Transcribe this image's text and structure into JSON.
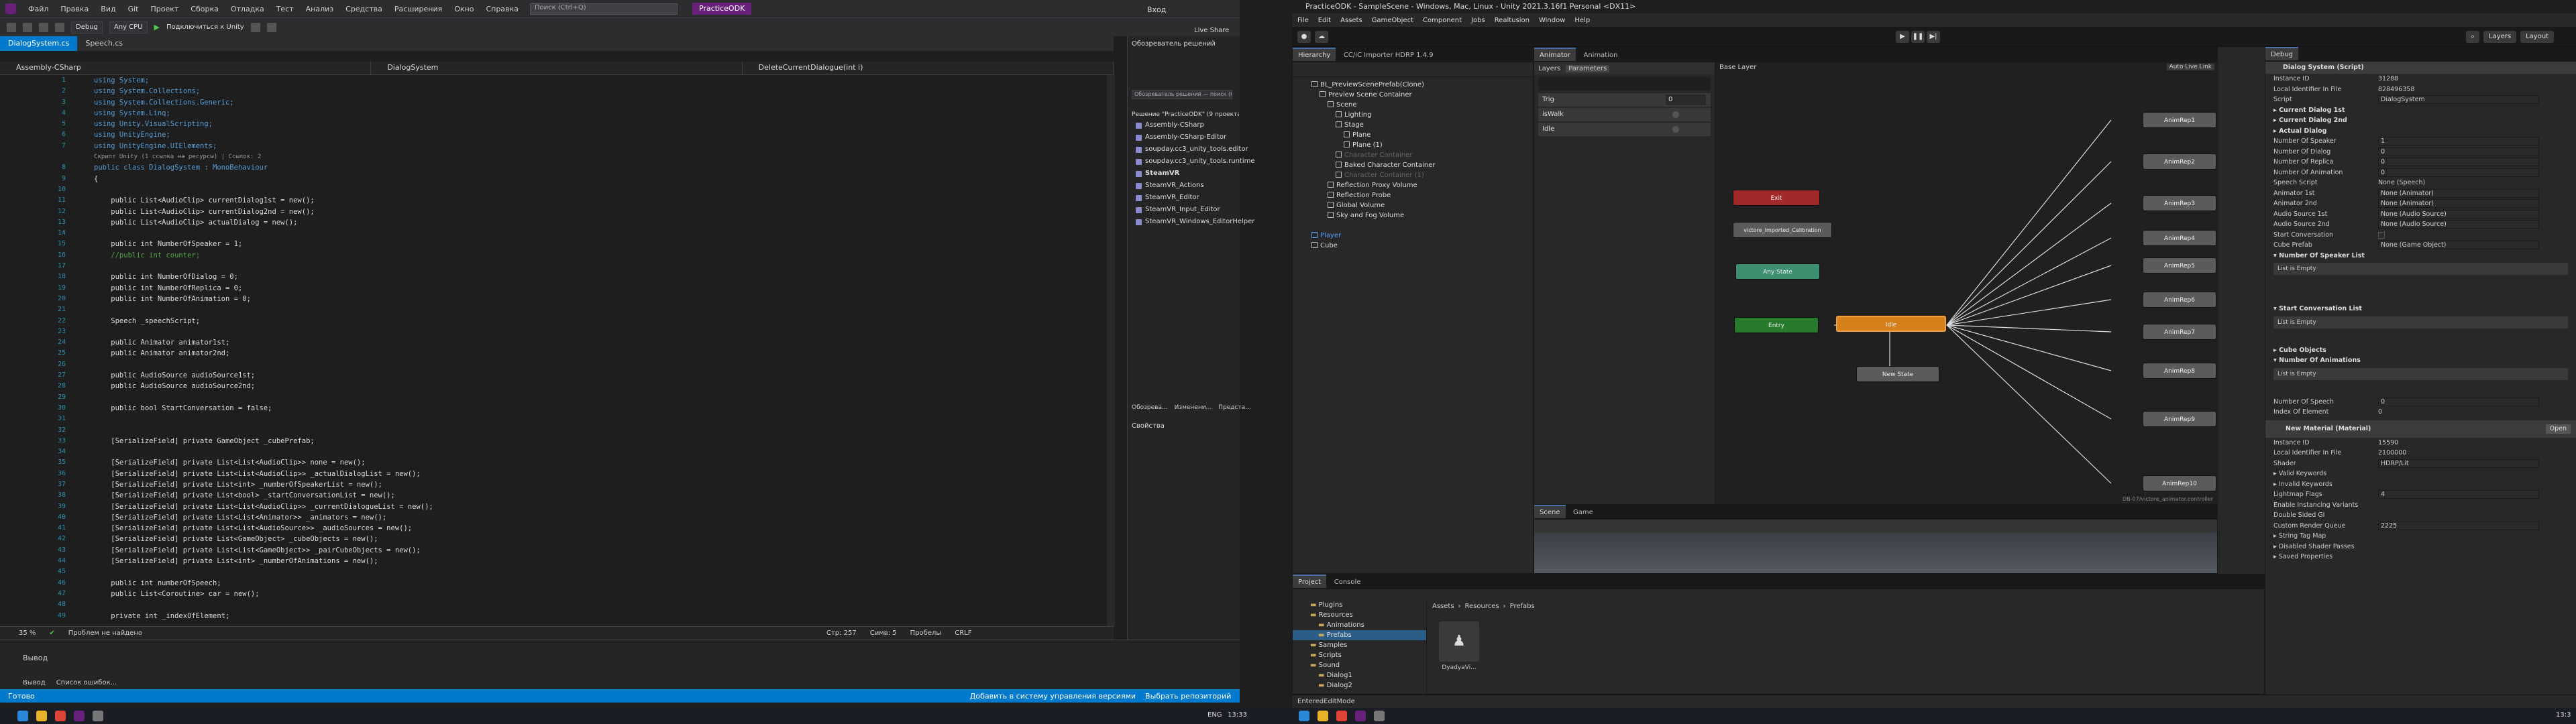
{
  "vs": {
    "menu": [
      "Файл",
      "Правка",
      "Вид",
      "Git",
      "Проект",
      "Сборка",
      "Отладка",
      "Тест",
      "Анализ",
      "Средства",
      "Расширения",
      "Окно",
      "Справка"
    ],
    "search_placeholder": "Поиск (Ctrl+Q)",
    "solution_name": "PracticeODK",
    "user": "Вход",
    "live_share": "Live Share",
    "config": "Debug",
    "platform": "Any CPU",
    "attach": "Подключиться к Unity",
    "tabs": [
      "DialogSystem.cs",
      "Speech.cs"
    ],
    "nav": [
      "Assembly-CSharp",
      "DialogSystem",
      "DeleteCurrentDialogue(int i)"
    ],
    "line_numbers": [
      "1",
      "2",
      "3",
      "4",
      "5",
      "6",
      "7",
      "8",
      "9",
      "10",
      "11",
      "12",
      "13",
      "14",
      "15",
      "16",
      "17",
      "18",
      "19",
      "20",
      "21",
      "22",
      "23",
      "24",
      "25",
      "26",
      "27",
      "28",
      "29",
      "30",
      "31",
      "32",
      "33",
      "34",
      "35",
      "36",
      "37",
      "38",
      "39",
      "40",
      "41",
      "42",
      "43",
      "44",
      "45",
      "46",
      "47",
      "48",
      "49",
      "50"
    ],
    "code": {
      "l1": "using System;",
      "l2": "using System.Collections;",
      "l3": "using System.Collections.Generic;",
      "l4": "using System.Linq;",
      "l5": "using Unity.VisualScripting;",
      "l6": "using UnityEngine;",
      "l7": "using UnityEngine.UIElements;",
      "hint1": "Скрипт Unity (1 ссылка на ресурсы) | Ссылок: 2",
      "l8": "public class DialogSystem : MonoBehaviour",
      "l9": "{",
      "l11": "    public List<AudioClip> currentDialog1st = new();",
      "l12": "    public List<AudioClip> currentDialog2nd = new();",
      "l13": "    public List<AudioClip> actualDialog = new();",
      "l15": "    public int NumberOfSpeaker = 1;",
      "l16": "    //public int counter;",
      "l18": "    public int NumberOfDialog = 0;",
      "l19": "    public int NumberOfReplica = 0;",
      "l20": "    public int NumberOfAnimation = 0;",
      "l22": "    Speech _speechScript;",
      "l24": "    public Animator animator1st;",
      "l25": "    public Animator animator2nd;",
      "l27": "    public AudioSource audioSource1st;",
      "l28": "    public AudioSource audioSource2nd;",
      "l30": "    public bool StartConversation = false;",
      "l33": "    [SerializeField] private GameObject _cubePrefab;",
      "l35": "    [SerializeField] private List<List<AudioClip>> none = new();",
      "l36": "    [SerializeField] private List<List<AudioClip>> _actualDialogList = new();",
      "l37": "    [SerializeField] private List<int> _numberOfSpeakerList = new();",
      "l38": "    [SerializeField] private List<bool> _startConversationList = new();",
      "l39": "    [SerializeField] private List<List<AudioClip>> _currentDialogueList = new();",
      "l40": "    [SerializeField] private List<List<Animator>> _animators = new();",
      "l41": "    [SerializeField] private List<List<AudioSource>> _audioSources = new();",
      "l42": "    [SerializeField] private List<GameObject> _cubeObjects = new();",
      "l43": "    [SerializeField] private List<List<GameObject>> _pairCubeObjects = new();",
      "l44": "    [SerializeField] private List<int> _numberOfAnimations = new();",
      "l46": "    public int numberOfSpeech;",
      "l47": "    public List<Coroutine> car = new();",
      "l49": "    private int _indexOfElement;"
    },
    "editor_status": {
      "zoom": "35 %",
      "issues": "Проблем не найдено",
      "line": "Стр: 257",
      "col": "Симв: 5",
      "ws": "Пробелы",
      "eol": "CRLF"
    },
    "output": {
      "title": "Вывод",
      "tabs": [
        "Вывод",
        "Список ошибок..."
      ]
    },
    "statusbar": {
      "ready": "Готово",
      "add_vcs": "Добавить в систему управления версиями",
      "select_repo": "Выбрать репозиторий"
    },
    "solution_explorer": {
      "title": "Обозреватель решений",
      "search": "Обозреватель решений — поиск (Ctrl+;)",
      "solution": "Решение \"PracticeODK\" (9 проекта)",
      "items": [
        "Assembly-CSharp",
        "Assembly-CSharp-Editor",
        "soupday.cc3_unity_tools.editor",
        "soupday.cc3_unity_tools.runtime",
        "SteamVR",
        "SteamVR_Actions",
        "SteamVR_Editor",
        "SteamVR_Input_Editor",
        "SteamVR_Windows_EditorHelper"
      ],
      "bottom_tabs": [
        "Обозрева...",
        "Изменени...",
        "Предста..."
      ],
      "props": "Свойства"
    }
  },
  "unity": {
    "title": "PracticeODK - SampleScene - Windows, Mac, Linux - Unity 2021.3.16f1 Personal <DX11>",
    "menu": [
      "File",
      "Edit",
      "Assets",
      "GameObject",
      "Component",
      "Jobs",
      "Realtusion",
      "Window",
      "Help"
    ],
    "layers": "Layers",
    "layout": "Layout",
    "hierarchy": {
      "tab": "Hierarchy",
      "items": [
        "BL_PreviewScenePrefab(Clone)",
        "Preview Scene Container",
        "Scene",
        "Lighting",
        "Stage",
        "Plane",
        "Plane (1)",
        "Character Container",
        "Baked Character Container",
        "Character Container (1)",
        "Reflection Proxy Volume",
        "Reflection Probe",
        "Global Volume",
        "Sky and Fog Volume",
        "Player",
        "Cube"
      ]
    },
    "cc_tab": "CC/iC Importer HDRP 1.4.9",
    "animator": {
      "tab": "Animator",
      "tab2": "Animation",
      "layers": "Layers",
      "params": "Parameters",
      "base_layer": "Base Layer",
      "auto_live": "Auto Live Link",
      "parameters": [
        "Trig",
        "isWalk",
        "Idle"
      ],
      "trig_val": "0",
      "path": "DB-07/victore_animator.controller",
      "states": {
        "exit": "Exit",
        "victore": "victore_Imported_Calibration",
        "any": "Any State",
        "entry": "Entry",
        "idle": "Idle",
        "new_state": "New State",
        "anims": [
          "AnimRep1",
          "AnimRep2",
          "AnimRep3",
          "AnimRep4",
          "AnimRep5",
          "AnimRep6",
          "AnimRep7",
          "AnimRep8",
          "AnimRep9",
          "AnimRep10"
        ]
      }
    },
    "scene": {
      "tab": "Scene",
      "tab2": "Game"
    },
    "project": {
      "tab": "Project",
      "tab2": "Console",
      "breadcrumb": [
        "Assets",
        "Resources",
        "Prefabs"
      ],
      "tree": [
        "Plugins",
        "Resources",
        "Animations",
        "Prefabs",
        "Samples",
        "Scripts",
        "Sound",
        "Dialog1",
        "Dialog2"
      ],
      "asset": "DyadyaVi..."
    },
    "status": "EnteredEditMode",
    "inspector": {
      "tab": "Debug",
      "component": "Dialog System (Script)",
      "rows": [
        [
          "Instance ID",
          "31288"
        ],
        [
          "Local Identifier In File",
          "828496358"
        ],
        [
          "Script",
          "DialogSystem"
        ]
      ],
      "b1": "Current Dialog 1st",
      "b2": "Current Dialog 2nd",
      "b3": "Actual Dialog",
      "ints": [
        [
          "Number Of Speaker",
          "1"
        ],
        [
          "Number Of Dialog",
          "0"
        ],
        [
          "Number Of Replica",
          "0"
        ],
        [
          "Number Of Animation",
          "0"
        ]
      ],
      "speech": [
        "Speech Script",
        "None (Speech)"
      ],
      "objs": [
        [
          "Animator 1st",
          "None (Animator)"
        ],
        [
          "Animator 2nd",
          "None (Animator)"
        ],
        [
          "Audio Source 1st",
          "None (Audio Source)"
        ],
        [
          "Audio Source 2nd",
          "None (Audio Source)"
        ]
      ],
      "start": "Start Conversation",
      "cube_prefab": [
        "Cube Prefab",
        "None (Game Object)"
      ],
      "list1": "Number Of Speaker List",
      "list2": "Start Conversation List",
      "list3": "Cube Objects",
      "list4": "Number Of Animations",
      "empty": "List is Empty",
      "zero": "0",
      "num_speech": [
        "Number Of Speech",
        "0"
      ],
      "index": [
        "Index Of Element",
        "0"
      ],
      "material": "New Material (Material)",
      "open": "Open",
      "mrows": [
        [
          "Instance ID",
          "15590"
        ],
        [
          "Local Identifier In File",
          "2100000"
        ],
        [
          "Shader",
          "HDRP/Lit"
        ]
      ],
      "kw": [
        "Valid Keywords",
        "Invalid Keywords"
      ],
      "mprops": [
        [
          "Lightmap Flags",
          "4"
        ],
        [
          "Enable Instancing Variants",
          ""
        ],
        [
          "Double Sided GI",
          ""
        ],
        [
          "Custom Render Queue",
          "2225"
        ]
      ],
      "tail": [
        "String Tag Map",
        "Disabled Shader Passes",
        "Saved Properties"
      ]
    }
  },
  "taskbar": {
    "lang": "ENG",
    "time": "13:33",
    "time2": "13:3"
  },
  "colors": {
    "vs_accent": "#007acc",
    "vs_title": "#68217a",
    "unity_idle": "#d6801a",
    "unity_entry": "#287a2c",
    "unity_exit": "#a02a2a"
  }
}
